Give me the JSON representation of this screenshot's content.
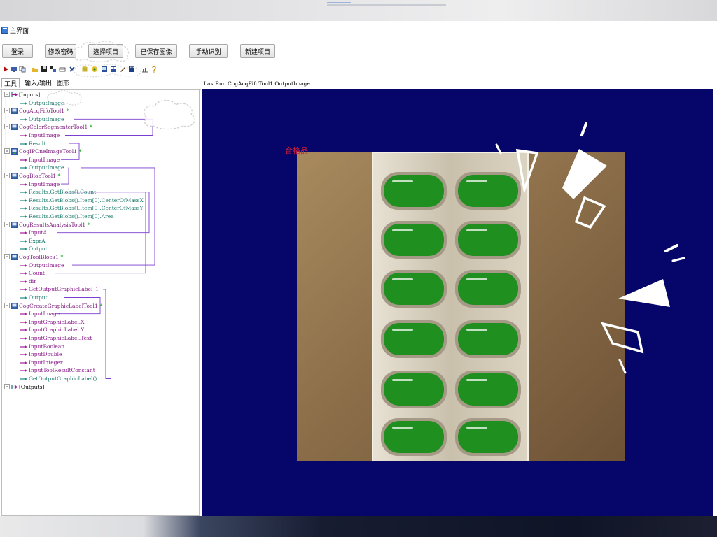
{
  "window": {
    "title": "主界面"
  },
  "main_buttons": [
    "登录",
    "修改密码",
    "选择项目",
    "已保存图像",
    "手动识别",
    "新建项目"
  ],
  "tabs": [
    "工具",
    "输入/输出",
    "图形"
  ],
  "tree": [
    {
      "label": "[Inputs]",
      "kind": "root"
    },
    {
      "label": "OutputImage",
      "kind": "out"
    },
    {
      "label": "CogAcqFifoTool1",
      "kind": "tool",
      "star": "*"
    },
    {
      "label": "OutputImage",
      "kind": "out"
    },
    {
      "label": "CogColorSegmenterTool1",
      "kind": "tool",
      "star": "*"
    },
    {
      "label": "InputImage",
      "kind": "in"
    },
    {
      "label": "Result",
      "kind": "out"
    },
    {
      "label": "CogIPOneImageTool1",
      "kind": "tool",
      "star": "*"
    },
    {
      "label": "InputImage",
      "kind": "in"
    },
    {
      "label": "OutputImage",
      "kind": "out"
    },
    {
      "label": "CogBlobTool1",
      "kind": "tool",
      "star": "*"
    },
    {
      "label": "InputImage",
      "kind": "in"
    },
    {
      "label": "Results.GetBlobs().Count",
      "kind": "out"
    },
    {
      "label": "Results.GetBlobs().Item[0].CenterOfMassX",
      "kind": "out"
    },
    {
      "label": "Results.GetBlobs().Item[0].CenterOfMassY",
      "kind": "out"
    },
    {
      "label": "Results.GetBlobs().Item[0].Area",
      "kind": "out"
    },
    {
      "label": "CogResultsAnalysisTool1",
      "kind": "tool",
      "star": "*"
    },
    {
      "label": "InputA",
      "kind": "in"
    },
    {
      "label": "ExprA",
      "kind": "out"
    },
    {
      "label": "Output",
      "kind": "out"
    },
    {
      "label": "CogToolBlock1",
      "kind": "tool",
      "star": "*"
    },
    {
      "label": "OutputImage",
      "kind": "in"
    },
    {
      "label": "Count",
      "kind": "in"
    },
    {
      "label": "dir",
      "kind": "in"
    },
    {
      "label": "GetOutputGraphicLabel_1",
      "kind": "in"
    },
    {
      "label": "Output",
      "kind": "out"
    },
    {
      "label": "CogCreateGraphicLabelTool1",
      "kind": "tool",
      "star": "*"
    },
    {
      "label": "InputImage",
      "kind": "in"
    },
    {
      "label": "InputGraphicLabel.X",
      "kind": "in"
    },
    {
      "label": "InputGraphicLabel.Y",
      "kind": "in"
    },
    {
      "label": "InputGraphicLabel.Text",
      "kind": "in"
    },
    {
      "label": "InputBoolean",
      "kind": "in"
    },
    {
      "label": "InputDouble",
      "kind": "in"
    },
    {
      "label": "InputInteger",
      "kind": "in"
    },
    {
      "label": "InputToolResultConstant",
      "kind": "in"
    },
    {
      "label": "GetOutputGraphicLabel()",
      "kind": "out"
    },
    {
      "label": "[Outputs]",
      "kind": "root"
    }
  ],
  "viewer": {
    "header": "LastRun.CogAcqFifoTool1.OutputImage",
    "result_text": "合格品"
  },
  "colors": {
    "viewport_bg": "#06066a",
    "pill_green": "#1f8f1f",
    "result_text": "#d0203a",
    "link_purple": "#7a3fd0",
    "out_arrow": "#1a8a7a",
    "in_arrow": "#a01a9a"
  }
}
